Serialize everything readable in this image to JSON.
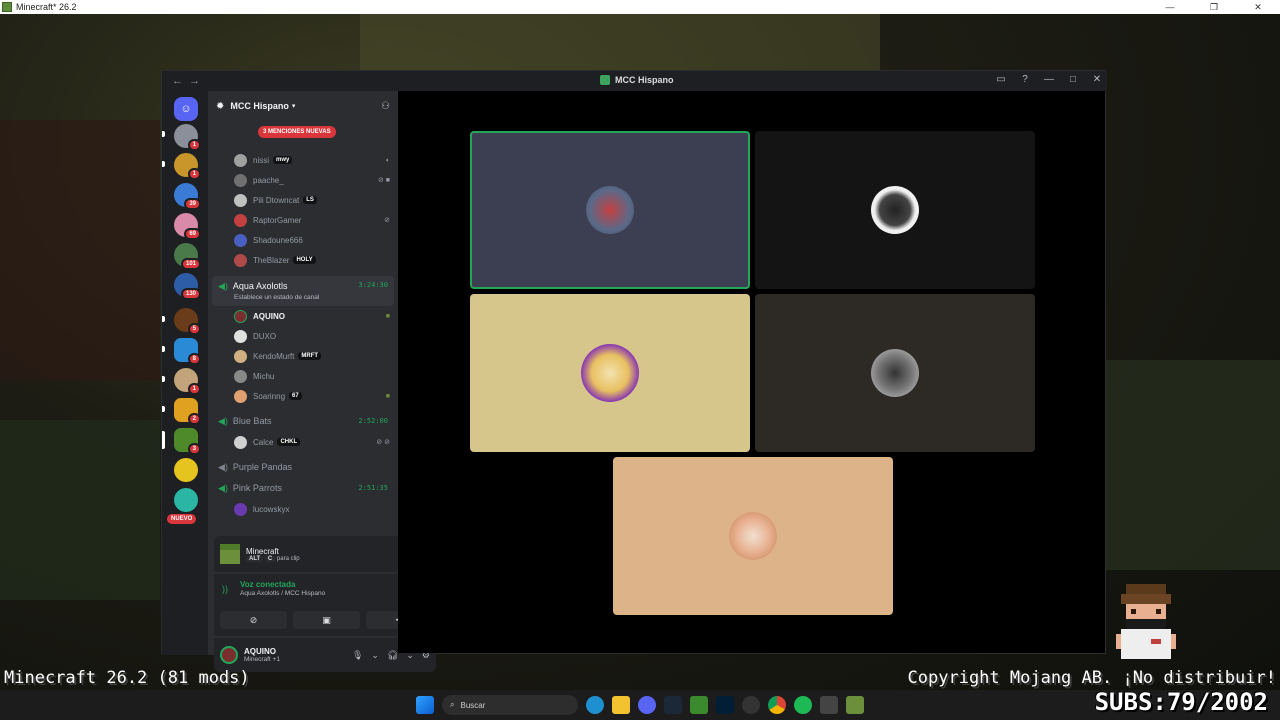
{
  "minecraft": {
    "window_title": "Minecraft* 26.2",
    "version_text": "Minecraft 26.2 (81 mods)",
    "copyright_text": "Copyright Mojang AB. ¡No distribuir!"
  },
  "overlay": {
    "subs": "SUBS:79/2002"
  },
  "discord": {
    "window_title": "MCC Hispano",
    "server_name": "MCC Hispano",
    "mentions_pill": "3 MENCIONES NUEVAS",
    "new_pill": "NUEVO",
    "rail_badges": [
      "1",
      "1",
      "39",
      "69",
      "101",
      "130",
      "5",
      "8",
      "1",
      "2",
      "3"
    ],
    "top_users": [
      {
        "name": "nissi",
        "tag": "mwy"
      },
      {
        "name": "paache_",
        "tag": ""
      },
      {
        "name": "Pili Dtowncat",
        "tag": "LS"
      },
      {
        "name": "RaptorGamer",
        "tag": ""
      },
      {
        "name": "Shadoune666",
        "tag": ""
      },
      {
        "name": "TheBlazer",
        "tag": "HOLY"
      }
    ],
    "active_channel": {
      "name": "Aqua Axolotls",
      "time": "3:24:30",
      "status_prompt": "Establece un estado de canal"
    },
    "aqua_users": [
      {
        "name": "AQUINO",
        "tag": ""
      },
      {
        "name": "DUXO",
        "tag": ""
      },
      {
        "name": "KendoMurft",
        "tag": "MRFT"
      },
      {
        "name": "Michu",
        "tag": ""
      },
      {
        "name": "Soarinng",
        "tag": "67"
      }
    ],
    "blue_channel": {
      "name": "Blue Bats",
      "time": "2:52:00"
    },
    "blue_users": [
      {
        "name": "Calce",
        "tag": "CHKL"
      }
    ],
    "purple_channel": {
      "name": "Purple Pandas"
    },
    "pink_channel": {
      "name": "Pink Parrots",
      "time": "2:51:35"
    },
    "pink_users": [
      {
        "name": "lucowskyx"
      }
    ],
    "activity": {
      "game": "Minecraft",
      "key1": "ALT",
      "key2": "C",
      "hint": "para clip"
    },
    "voice": {
      "status": "Voz conectada",
      "channel": "Aqua Axolotls / MCC Hispano"
    },
    "user": {
      "name": "AQUINO",
      "activity": "Minecraft +1"
    }
  },
  "taskbar": {
    "search_placeholder": "Buscar"
  },
  "colors": {
    "accent_green": "#23a55a",
    "mention_red": "#da373c",
    "tile1": "#3c3f52",
    "tile2": "#141414",
    "tile3": "#d6c68c",
    "tile4": "#2d2a26",
    "tile5": "#ddb489"
  },
  "icons": [
    "discord-icon",
    "speaker-icon",
    "gear-icon",
    "mic-icon",
    "headphones-icon",
    "screen-share-icon",
    "camera-off-icon",
    "activity-icon",
    "disconnect-icon"
  ]
}
